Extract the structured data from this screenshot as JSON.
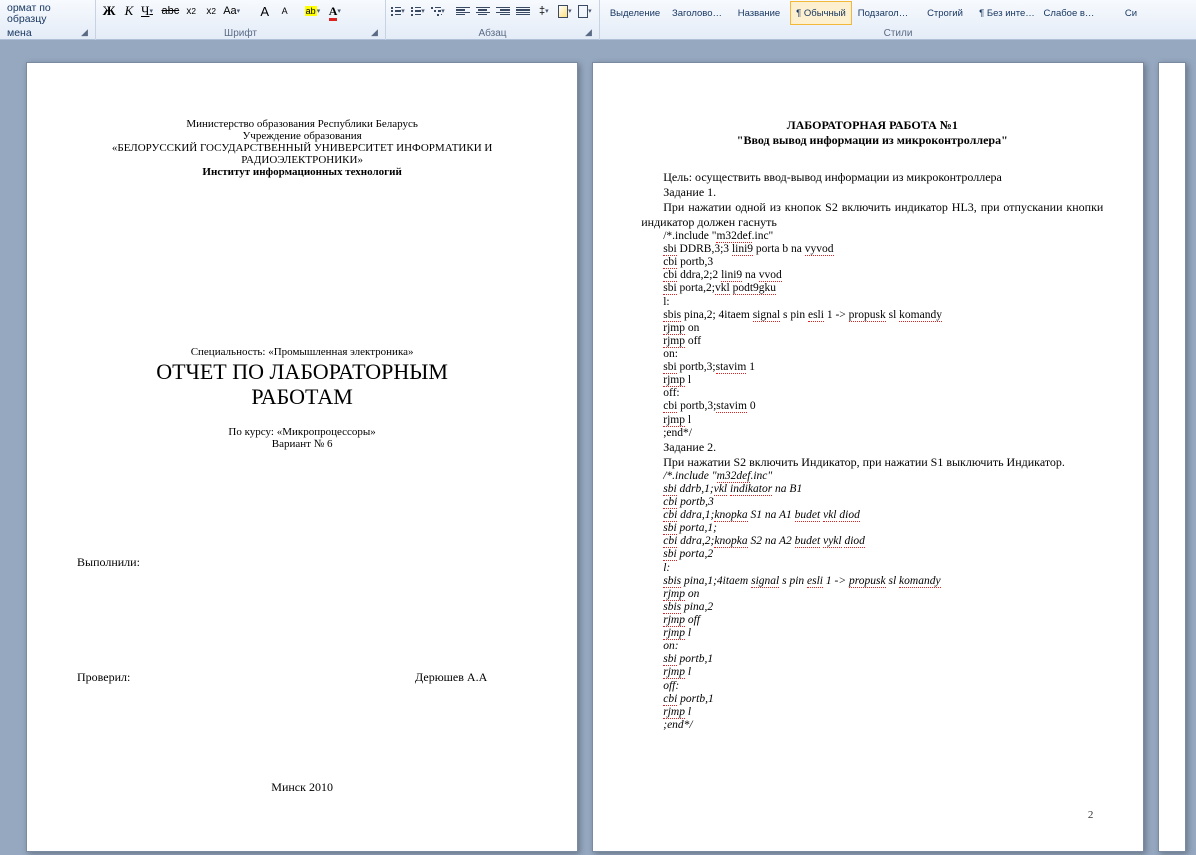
{
  "ribbon": {
    "clipboard": {
      "format_painter": "ормат по образцу",
      "line2": "мена",
      "label": ""
    },
    "font": {
      "bold": "Ж",
      "italic": "К",
      "underline": "Ч",
      "strike": "abc",
      "sub": "x₂",
      "sup": "x²",
      "case": "Aa",
      "highlight": "ab",
      "color": "A",
      "grow": "A",
      "shrink": "A",
      "label": "Шрифт"
    },
    "paragraph": {
      "label": "Абзац"
    },
    "styles": {
      "items": [
        "Выделение",
        "Заголово…",
        "Название",
        "¶ Обычный",
        "Подзагол…",
        "Строгий",
        "¶ Без инте…",
        "Слабое в…",
        "Си"
      ],
      "selected_index": 3,
      "label": "Стили"
    }
  },
  "page1": {
    "line1": "Министерство образования Республики Беларусь",
    "line2": "Учреждение образования",
    "line3": "«БЕЛОРУССКИЙ  ГОСУДАРСТВЕННЫЙ  УНИВЕРСИТЕТ ИНФОРМАТИКИ И",
    "line4": "РАДИОЭЛЕКТРОНИКИ»",
    "line5": "Институт информационных технологий",
    "spec": "Специальность: «Промышленная электроника»",
    "title1": "ОТЧЕТ ПО ЛАБОРАТОРНЫМ",
    "title2": "РАБОТАМ",
    "course": "По курсу: «Микропроцессоры»",
    "variant": "Вариант № 6",
    "executed": "Выполнили:",
    "checked_l": "Проверил:",
    "checked_r": "Дерюшев А.А",
    "city": "Минск 2010"
  },
  "page2": {
    "h1": "ЛАБОРАТОРНАЯ РАБОТА №1",
    "h2": "\"Ввод вывод информации из микроконтроллера\"",
    "goal": "Цель: осуществить ввод-вывод информации из микроконтроллера",
    "task1": "Задание 1.",
    "t1text": "При нажатии одной из кнопок S2 включить индикатор HL3, при отпускании кнопки индикатор должен гаснуть",
    "code1": [
      "/*.include \"m32def.inc\"",
      "sbi DDRB,3;3 lini9 porta b na vyvod",
      "cbi portb,3",
      "cbi ddra,2;2 lini9 na vvod",
      "sbi porta,2;vkl podt9gku",
      "l:",
      "sbis pina,2; 4itaem signal s pin esli 1 -> propusk sl komandy",
      "rjmp on",
      "rjmp off",
      "on:",
      "sbi portb,3;stavim 1",
      "rjmp l",
      "off:",
      "cbi portb,3;stavim 0",
      "rjmp l",
      ";end*/"
    ],
    "task2": "Задание 2.",
    "t2text": "При нажатии S2 включить Индикатор, при нажатии S1 выключить Индикатор.",
    "code2": [
      "/*.include \"m32def.inc\"",
      "sbi ddrb,1;vkl indikator na B1",
      "cbi portb,3",
      "cbi ddra,1;knopka S1 na A1 budet vkl diod",
      "sbi porta,1;",
      "cbi ddra,2;knopka S2 na A2 budet vykl diod",
      "sbi porta,2",
      "l:",
      "sbis pina,1;4itaem signal s pin esli 1 -> propusk sl komandy",
      "rjmp on",
      "sbis pina,2",
      "rjmp off",
      "rjmp l",
      "on:",
      "sbi portb,1",
      "rjmp l",
      "off:",
      "cbi portb,1",
      "rjmp l",
      ";end*/"
    ],
    "page_num": "2"
  }
}
